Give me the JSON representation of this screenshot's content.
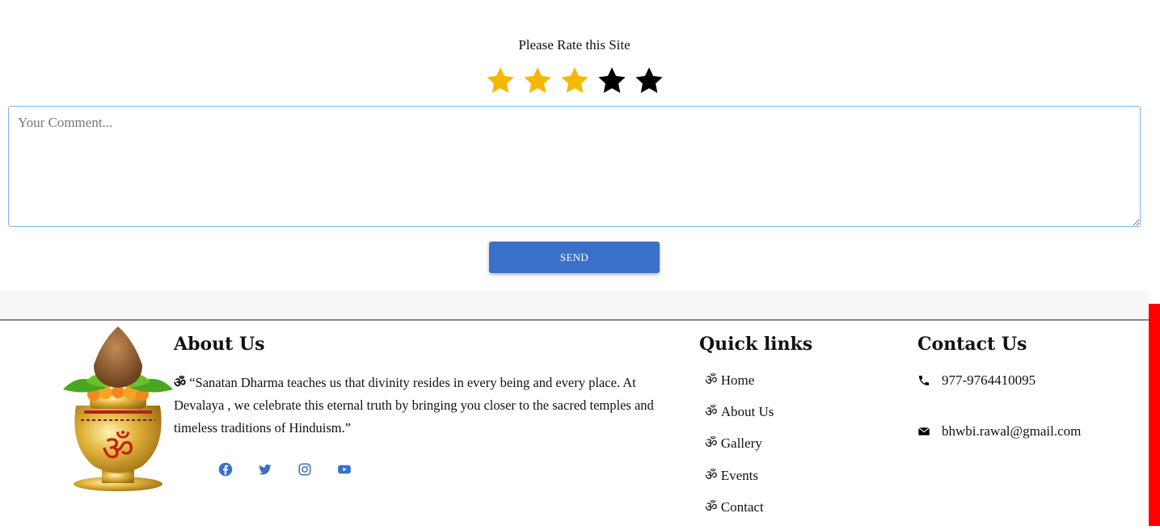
{
  "rating": {
    "title": "Please Rate this Site",
    "max_stars": 5,
    "selected": 3,
    "filled_color": "#f5b800",
    "empty_color": "#000000"
  },
  "comment": {
    "placeholder": "Your Comment...",
    "value": ""
  },
  "send_label": "SEND",
  "footer": {
    "about": {
      "heading": "About Us",
      "om": "ॐ",
      "text": "“Sanatan Dharma teaches us that divinity resides in every being and every place. At Devalaya , we celebrate this eternal truth by bringing you closer to the sacred temples and timeless traditions of Hinduism.”",
      "socials": [
        "facebook-icon",
        "twitter-icon",
        "instagram-icon",
        "youtube-icon"
      ]
    },
    "quick_links": {
      "heading": "Quick links",
      "items": [
        "ॐ Home",
        "ॐ About Us",
        "ॐ Gallery",
        "ॐ Events",
        "ॐ Contact"
      ]
    },
    "contact": {
      "heading": "Contact Us",
      "phone": "977-9764410095",
      "email": "bhwbi.rawal@gmail.com"
    }
  },
  "colors": {
    "accent": "#3a70ca",
    "scroll_marker": "#ff0000"
  }
}
